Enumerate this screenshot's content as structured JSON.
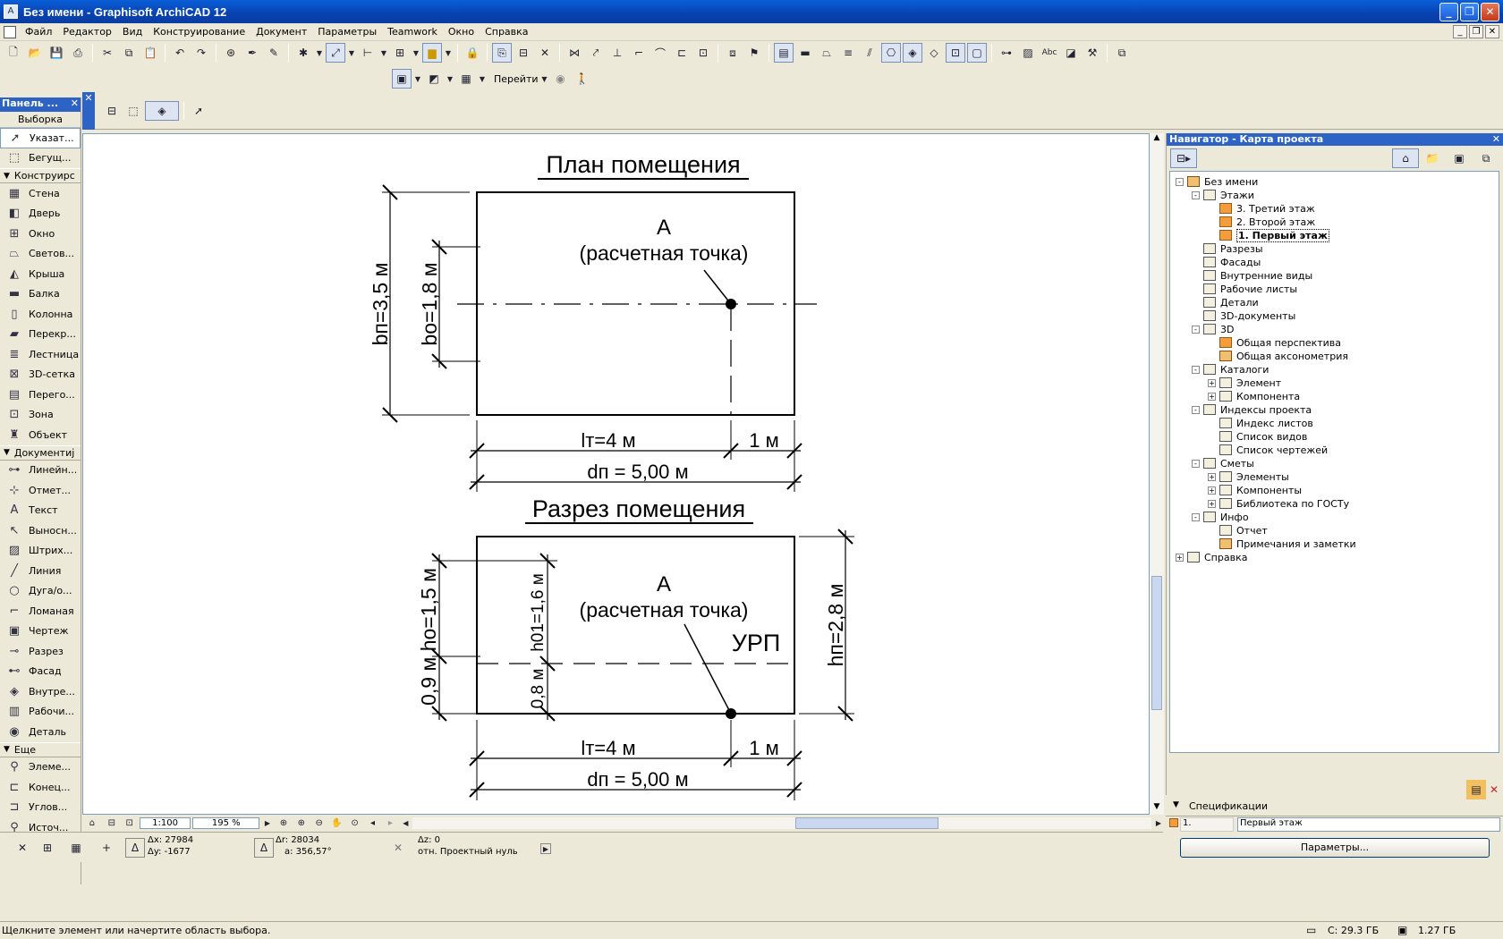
{
  "window": {
    "title": "Без имени - Graphisoft ArchiCAD 12"
  },
  "menu": [
    "Файл",
    "Редактор",
    "Вид",
    "Конструирование",
    "Документ",
    "Параметры",
    "Teamwork",
    "Окно",
    "Справка"
  ],
  "toolbar2": {
    "goto_label": "Перейти"
  },
  "left_panel": {
    "title": "Панель ...",
    "selection": "Выборка",
    "items_top": [
      {
        "label": "Указат...",
        "icon": "arrow-icon"
      },
      {
        "label": "Бегущ...",
        "icon": "marquee-icon"
      }
    ],
    "section_design": "Конструирс",
    "design_items": [
      {
        "label": "Стена",
        "icon": "wall-icon"
      },
      {
        "label": "Дверь",
        "icon": "door-icon"
      },
      {
        "label": "Окно",
        "icon": "window-icon"
      },
      {
        "label": "Светов...",
        "icon": "skylight-icon"
      },
      {
        "label": "Крыша",
        "icon": "roof-icon"
      },
      {
        "label": "Балка",
        "icon": "beam-icon"
      },
      {
        "label": "Колонна",
        "icon": "column-icon"
      },
      {
        "label": "Перекр...",
        "icon": "slab-icon"
      },
      {
        "label": "Лестница",
        "icon": "stair-icon"
      },
      {
        "label": "3D-сетка",
        "icon": "mesh-icon"
      },
      {
        "label": "Перего...",
        "icon": "curtainwall-icon"
      },
      {
        "label": "Зона",
        "icon": "zone-icon"
      },
      {
        "label": "Объект",
        "icon": "object-icon"
      }
    ],
    "section_document": "Документиј",
    "document_items": [
      {
        "label": "Линейн...",
        "icon": "dimension-icon"
      },
      {
        "label": "Отмет...",
        "icon": "level-icon"
      },
      {
        "label": "Текст",
        "icon": "text-icon"
      },
      {
        "label": "Выносн...",
        "icon": "label-icon"
      },
      {
        "label": "Штрих...",
        "icon": "fill-icon"
      },
      {
        "label": "Линия",
        "icon": "line-icon"
      },
      {
        "label": "Дуга/о...",
        "icon": "arc-icon"
      },
      {
        "label": "Ломаная",
        "icon": "polyline-icon"
      },
      {
        "label": "Чертеж",
        "icon": "drawing-icon"
      },
      {
        "label": "Разрез",
        "icon": "section-icon"
      },
      {
        "label": "Фасад",
        "icon": "elevation-icon"
      },
      {
        "label": "Внутре...",
        "icon": "interior-icon"
      },
      {
        "label": "Рабочи...",
        "icon": "worksheet-icon"
      },
      {
        "label": "Деталь",
        "icon": "detail-icon"
      }
    ],
    "section_more": "Еще",
    "more_items": [
      {
        "label": "Элеме...",
        "icon": "element-icon"
      },
      {
        "label": "Конец...",
        "icon": "end-icon"
      },
      {
        "label": "Углов...",
        "icon": "corner-icon"
      },
      {
        "label": "Источ...",
        "icon": "lamp-icon"
      }
    ]
  },
  "drawing": {
    "plan_title": "План помещения",
    "point_label": "А",
    "point_sub": "(расчетная точка)",
    "plan_bp": "bп=3,5 м",
    "plan_bo": "bо=1,8 м",
    "plan_lt": "lт=4 м",
    "plan_1m": "1 м",
    "plan_dp": "dп = 5,00 м",
    "section_title": "Разрез помещения",
    "sec_hp": "hп=2,8 м",
    "sec_ho": "0,9 м hо=1,5 м",
    "sec_h01": "h01=1,6 м",
    "sec_08": "0,8 м",
    "sec_urp": "УРП",
    "sec_lt": "lт=4 м",
    "sec_1m": "1 м",
    "sec_dp": "dп = 5,00 м"
  },
  "hbar": {
    "scale": "1:100",
    "zoom": "195 %"
  },
  "coords": {
    "dx": "Δx: 27984",
    "dy": "Δy: -1677",
    "dr": "Δr: 28034",
    "a": "a: 356,57°",
    "dz": "Δz: 0",
    "ref": "отн. Проектный нуль"
  },
  "status": {
    "hint": "Щелкните элемент или начертите область выбора.",
    "disk_c": "C: 29.3 ГБ",
    "mem": "1.27 ГБ"
  },
  "navigator": {
    "title": "Навигатор - Карта проекта",
    "tree": [
      {
        "label": "Без имени",
        "level": 0,
        "exp": "-",
        "icon": "home"
      },
      {
        "label": "Этажи",
        "level": 1,
        "exp": "-",
        "icon": "doc"
      },
      {
        "label": "3. Третий этаж",
        "level": 2,
        "exp": "",
        "icon": "fl"
      },
      {
        "label": "2. Второй этаж",
        "level": 2,
        "exp": "",
        "icon": "fl"
      },
      {
        "label": "1. Первый этаж",
        "level": 2,
        "exp": "",
        "icon": "fl",
        "current": true
      },
      {
        "label": "Разрезы",
        "level": 1,
        "exp": "",
        "icon": "doc"
      },
      {
        "label": "Фасады",
        "level": 1,
        "exp": "",
        "icon": "doc"
      },
      {
        "label": "Внутренние виды",
        "level": 1,
        "exp": "",
        "icon": "doc"
      },
      {
        "label": "Рабочие листы",
        "level": 1,
        "exp": "",
        "icon": "doc"
      },
      {
        "label": "Детали",
        "level": 1,
        "exp": "",
        "icon": "doc"
      },
      {
        "label": "3D-документы",
        "level": 1,
        "exp": "",
        "icon": "doc"
      },
      {
        "label": "3D",
        "level": 1,
        "exp": "-",
        "icon": "doc"
      },
      {
        "label": "Общая перспектива",
        "level": 2,
        "exp": "",
        "icon": "fl"
      },
      {
        "label": "Общая аксонометрия",
        "level": 2,
        "exp": "",
        "icon": "home"
      },
      {
        "label": "Каталоги",
        "level": 1,
        "exp": "-",
        "icon": "doc"
      },
      {
        "label": "Элемент",
        "level": 2,
        "exp": "+",
        "icon": "doc"
      },
      {
        "label": "Компонента",
        "level": 2,
        "exp": "+",
        "icon": "doc"
      },
      {
        "label": "Индексы проекта",
        "level": 1,
        "exp": "-",
        "icon": "doc"
      },
      {
        "label": "Индекс листов",
        "level": 2,
        "exp": "",
        "icon": "doc"
      },
      {
        "label": "Список видов",
        "level": 2,
        "exp": "",
        "icon": "doc"
      },
      {
        "label": "Список чертежей",
        "level": 2,
        "exp": "",
        "icon": "doc"
      },
      {
        "label": "Сметы",
        "level": 1,
        "exp": "-",
        "icon": "doc"
      },
      {
        "label": "Элементы",
        "level": 2,
        "exp": "+",
        "icon": "doc"
      },
      {
        "label": "Компоненты",
        "level": 2,
        "exp": "+",
        "icon": "doc"
      },
      {
        "label": "Библиотека по ГОСТу",
        "level": 2,
        "exp": "+",
        "icon": "doc"
      },
      {
        "label": "Инфо",
        "level": 1,
        "exp": "-",
        "icon": "doc"
      },
      {
        "label": "Отчет",
        "level": 2,
        "exp": "",
        "icon": "doc"
      },
      {
        "label": "Примечания и заметки",
        "level": 2,
        "exp": "",
        "icon": "home"
      },
      {
        "label": "Справка",
        "level": 0,
        "exp": "+",
        "icon": "doc"
      }
    ],
    "specs_label": "Спецификации",
    "spec_id": "1.",
    "spec_name": "Первый этаж",
    "params_button": "Параметры..."
  }
}
